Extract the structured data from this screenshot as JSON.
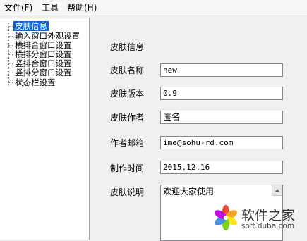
{
  "menu": {
    "items": [
      "文件(F)",
      "工具",
      "帮助(H)"
    ]
  },
  "tree": {
    "items": [
      {
        "label": "皮肤信息",
        "selected": true
      },
      {
        "label": "输入窗口外观设置",
        "selected": false
      },
      {
        "label": "横排合窗口设置",
        "selected": false
      },
      {
        "label": "横排分窗口设置",
        "selected": false
      },
      {
        "label": "竖排合窗口设置",
        "selected": false
      },
      {
        "label": "竖排分窗口设置",
        "selected": false
      },
      {
        "label": "状态栏设置",
        "selected": false
      }
    ]
  },
  "form": {
    "section_title": "皮肤信息",
    "name_label": "皮肤名称",
    "name_value": "new",
    "version_label": "皮肤版本",
    "version_value": "0.9",
    "author_label": "皮肤作者",
    "author_value": "匿名",
    "email_label": "作者邮箱",
    "email_value": "ime@sohu-rd.com",
    "date_label": "制作时间",
    "date_value": "2015.12.16",
    "desc_label": "皮肤说明",
    "desc_value": "欢迎大家使用"
  },
  "watermark": {
    "title": "软件之家",
    "url": "soft.duba.com"
  },
  "colors": {
    "selection": "#0a64d6",
    "window_bg": "#f0f0f0"
  }
}
